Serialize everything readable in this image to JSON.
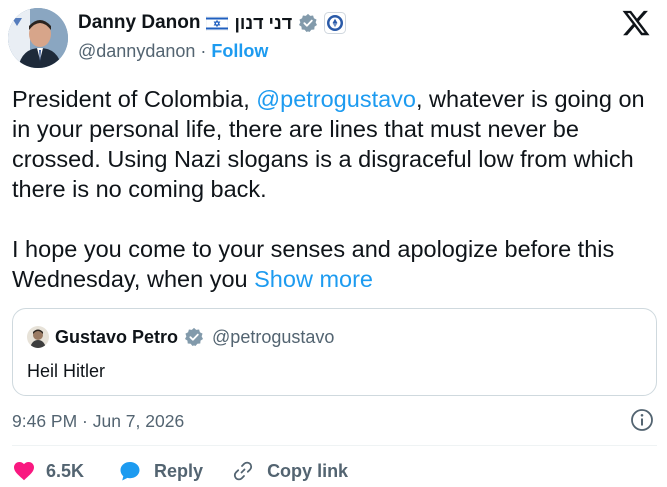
{
  "author": {
    "name": "Danny Danon",
    "hebrew_name": "דני דנון",
    "handle": "@dannydanon",
    "separator": "·",
    "follow_label": "Follow"
  },
  "tweet": {
    "para1_before": "President of Colombia, ",
    "para1_mention": "@petrogustavo",
    "para1_after": ", whatever is going on in your personal life, there are lines that must never be crossed. Using Nazi slogans is a disgraceful low from which there is no coming back.",
    "para2": "I hope you come to your senses and apologize before this Wednesday, when you ",
    "show_more": "Show more"
  },
  "quote": {
    "name": "Gustavo Petro",
    "handle": "@petrogustavo",
    "text": "Heil Hitler"
  },
  "timestamp": "9:46 PM · Jun 7, 2026",
  "actions": {
    "likes": "6.5K",
    "reply": "Reply",
    "copy_link": "Copy link"
  },
  "colors": {
    "accent": "#1d9bf0",
    "like": "#f91880",
    "muted": "#536471",
    "border": "#cfd9de"
  },
  "icons": [
    "x-logo-icon",
    "israel-flag-icon",
    "verified-badge-icon",
    "affiliate-badge-icon",
    "info-icon",
    "heart-icon",
    "reply-bubble-icon",
    "link-icon"
  ]
}
